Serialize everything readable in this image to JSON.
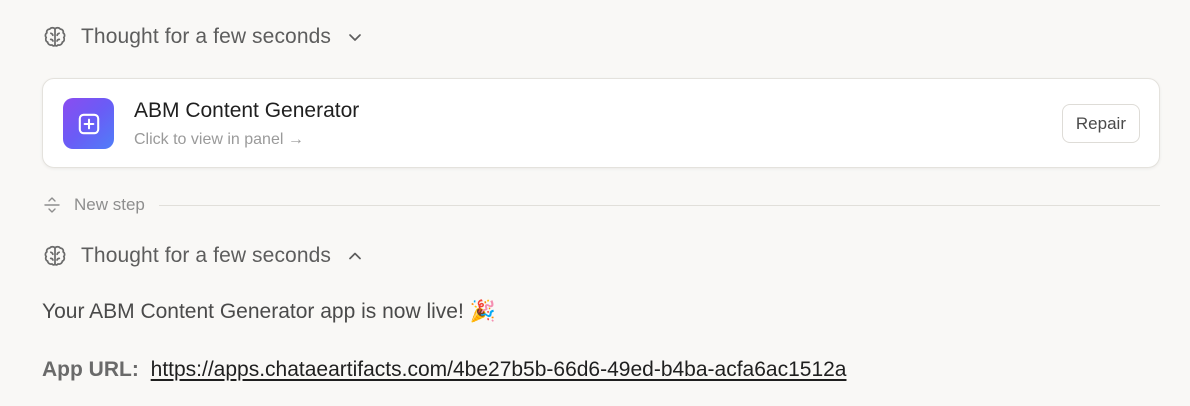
{
  "thought_1": {
    "label": "Thought for a few seconds",
    "icon": "brain-icon",
    "chevron": "chevron-down-icon"
  },
  "artifact_card": {
    "title": "ABM Content Generator",
    "subtitle": "Click to view in panel →",
    "icon": "plus-square-icon",
    "repair_label": "Repair",
    "icon_gradient": [
      "#8b4cf0",
      "#4f7ef8"
    ]
  },
  "new_step": {
    "label": "New step",
    "icon": "step-divider-icon"
  },
  "thought_2": {
    "label": "Thought for a few seconds",
    "icon": "brain-icon",
    "chevron": "chevron-up-icon"
  },
  "message": {
    "text": "Your ABM Content Generator app is now live! 🎉",
    "url_label": "App URL:",
    "url": "https://apps.chataeartifacts.com/4be27b5b-66d6-49ed-b4ba-acfa6ac1512a"
  }
}
